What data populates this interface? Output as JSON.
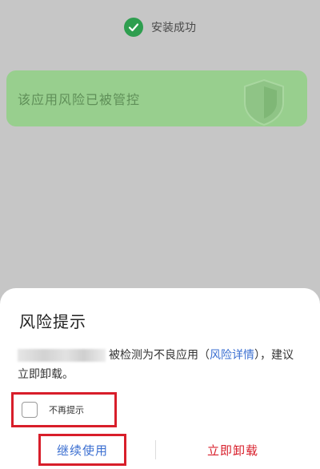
{
  "background": {
    "install_status": "安装成功",
    "risk_card_text": "该应用风险已被管控"
  },
  "dialog": {
    "title": "风险提示",
    "message_part1": "被检测为不良应用（",
    "risk_detail_link": "风险详情",
    "message_part2": "），建议立即卸载。",
    "checkbox_label": "不再提示",
    "checkbox_checked": false,
    "continue_label": "继续使用",
    "uninstall_label": "立即卸载"
  },
  "colors": {
    "success_green": "#2e9e4f",
    "card_green": "#98cf8e",
    "link_blue": "#3b6fd1",
    "danger_red": "#d81e2a"
  },
  "icons": {
    "install_status": "check-circle-icon",
    "risk_card": "shield-icon"
  }
}
